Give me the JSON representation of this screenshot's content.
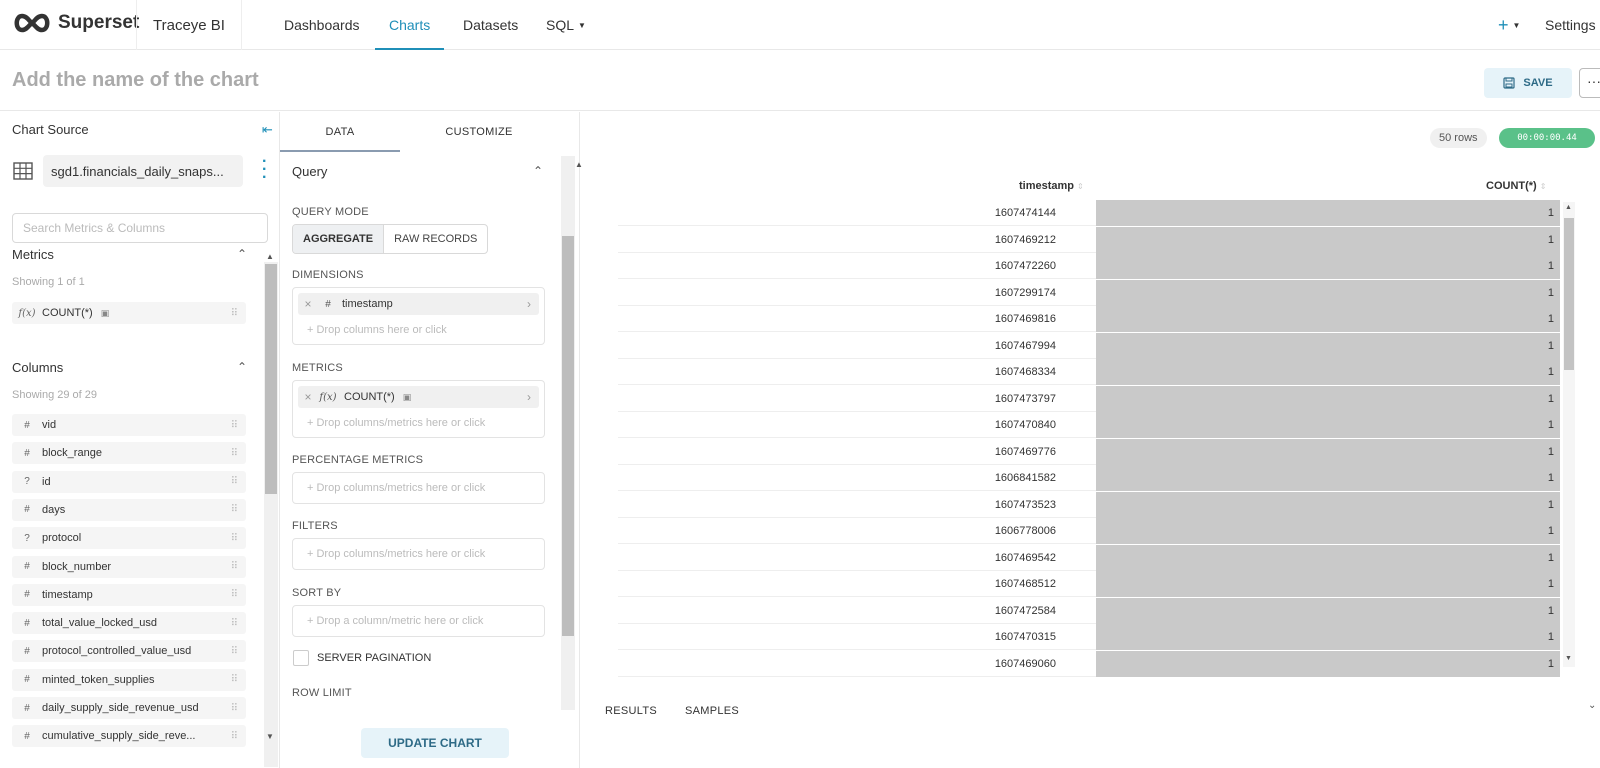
{
  "nav": {
    "logo_text": "Superset",
    "env_label": "Traceye BI",
    "items": [
      "Dashboards",
      "Charts",
      "Datasets",
      "SQL"
    ],
    "active": "Charts",
    "plus_label": "+",
    "settings_label": "Settings"
  },
  "header": {
    "title_placeholder": "Add the name of the chart",
    "save_label": "SAVE",
    "more_label": "···"
  },
  "datasource": {
    "section_label": "Chart Source",
    "name": "sgd1.financials_daily_snaps...",
    "search_placeholder": "Search Metrics & Columns",
    "metrics_title": "Metrics",
    "metrics_showing": "Showing 1 of 1",
    "metrics": [
      {
        "icon": "f(x)",
        "name": "COUNT(*)"
      }
    ],
    "columns_title": "Columns",
    "columns_showing": "Showing 29 of 29",
    "columns": [
      {
        "icon": "#",
        "name": "vid"
      },
      {
        "icon": "#",
        "name": "block_range"
      },
      {
        "icon": "?",
        "name": "id"
      },
      {
        "icon": "#",
        "name": "days"
      },
      {
        "icon": "?",
        "name": "protocol"
      },
      {
        "icon": "#",
        "name": "block_number"
      },
      {
        "icon": "#",
        "name": "timestamp"
      },
      {
        "icon": "#",
        "name": "total_value_locked_usd"
      },
      {
        "icon": "#",
        "name": "protocol_controlled_value_usd"
      },
      {
        "icon": "#",
        "name": "minted_token_supplies"
      },
      {
        "icon": "#",
        "name": "daily_supply_side_revenue_usd"
      },
      {
        "icon": "#",
        "name": "cumulative_supply_side_reve..."
      }
    ]
  },
  "control": {
    "tabs": [
      "DATA",
      "CUSTOMIZE"
    ],
    "query_title": "Query",
    "query_mode_label": "QUERY MODE",
    "mode_aggregate": "AGGREGATE",
    "mode_raw": "RAW RECORDS",
    "dimensions_label": "DIMENSIONS",
    "dimension_value": "timestamp",
    "drop_columns": "+ Drop columns here or click",
    "metrics_label": "METRICS",
    "metric_value": "COUNT(*)",
    "drop_cols_metrics": "+ Drop columns/metrics here or click",
    "pct_metrics_label": "PERCENTAGE METRICS",
    "filters_label": "FILTERS",
    "sort_by_label": "SORT BY",
    "drop_sort": "+ Drop a column/metric here or click",
    "server_pagination_label": "SERVER PAGINATION",
    "row_limit_label": "ROW LIMIT",
    "update_label": "UPDATE CHART"
  },
  "results": {
    "rows_badge": "50 rows",
    "timer": "00:00:00.44",
    "col_timestamp": "timestamp",
    "col_count": "COUNT(*)",
    "rows": [
      [
        "1607474144",
        "1"
      ],
      [
        "1607469212",
        "1"
      ],
      [
        "1607472260",
        "1"
      ],
      [
        "1607299174",
        "1"
      ],
      [
        "1607469816",
        "1"
      ],
      [
        "1607467994",
        "1"
      ],
      [
        "1607468334",
        "1"
      ],
      [
        "1607473797",
        "1"
      ],
      [
        "1607470840",
        "1"
      ],
      [
        "1607469776",
        "1"
      ],
      [
        "1606841582",
        "1"
      ],
      [
        "1607473523",
        "1"
      ],
      [
        "1606778006",
        "1"
      ],
      [
        "1607469542",
        "1"
      ],
      [
        "1607468512",
        "1"
      ],
      [
        "1607472584",
        "1"
      ],
      [
        "1607470315",
        "1"
      ],
      [
        "1607469060",
        "1"
      ]
    ],
    "tab_results": "RESULTS",
    "tab_samples": "SAMPLES"
  },
  "colors": {
    "accent": "#1f8fb8",
    "save_bg": "#e6f3f9",
    "timer_bg": "#5ac189",
    "bar_bg": "#c9c9c9"
  }
}
